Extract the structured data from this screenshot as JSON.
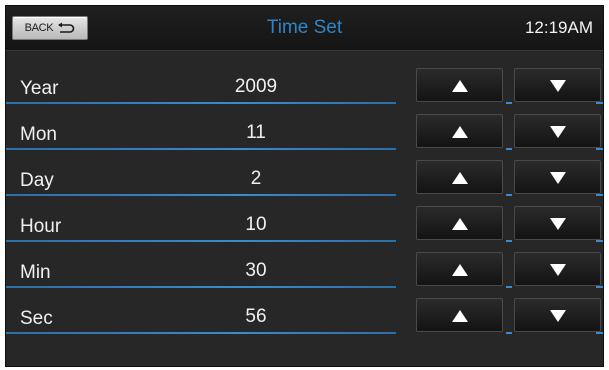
{
  "header": {
    "back_label": "BACK",
    "title": "Time Set",
    "clock": "12:19AM"
  },
  "rows": [
    {
      "label": "Year",
      "value": "2009"
    },
    {
      "label": "Mon",
      "value": "11"
    },
    {
      "label": "Day",
      "value": "2"
    },
    {
      "label": "Hour",
      "value": "10"
    },
    {
      "label": "Min",
      "value": "30"
    },
    {
      "label": "Sec",
      "value": "56"
    }
  ],
  "icons": {
    "back": "return-arrow-icon",
    "up": "up-triangle-icon",
    "down": "down-triangle-icon"
  },
  "colors": {
    "title": "#2f84c6",
    "divider": "#3b8ad0",
    "background": "#272727"
  }
}
